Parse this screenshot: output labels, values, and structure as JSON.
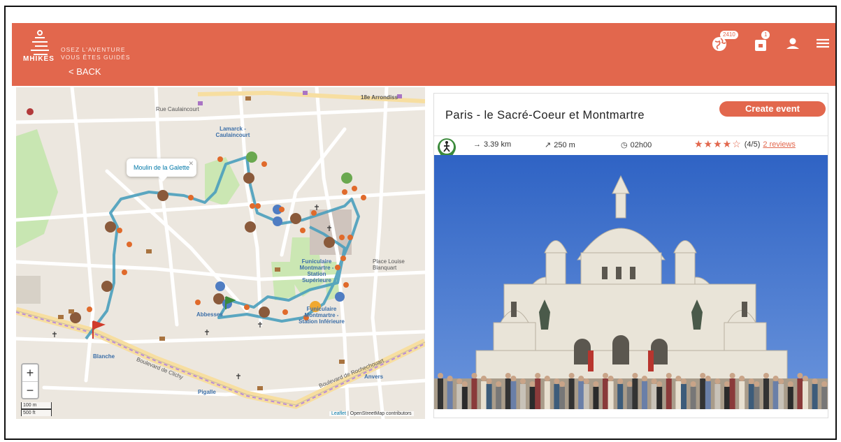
{
  "header": {
    "logo_text": "MHIKES",
    "tagline_line1": "OSEZ L'AVENTURE",
    "tagline_line2": "VOUS ÊTES GUIDÉS",
    "back_label": "< BACK",
    "globe_badge": "2410",
    "cart_badge": "1",
    "icons": [
      "globe-icon",
      "cart-icon",
      "user-icon",
      "menu-icon"
    ],
    "accent_color": "#e2674d"
  },
  "map": {
    "popup_label": "Moulin de la Galette",
    "zoom_in": "+",
    "zoom_out": "−",
    "scale_m": "100 m",
    "scale_ft": "500 ft",
    "attribution_leaflet": "Leaflet",
    "attribution_osm": "| OpenStreetMap contributors",
    "labels": {
      "arrondissement": "18e Arrondiss",
      "lamarck": "Lamarck - Caulaincourt",
      "funiculaire_sup": "Funiculaire Montmartre - Station Supérieure",
      "funiculaire_inf": "Funiculaire Montmartre - Station Inférieure",
      "place_louise": "Place Louise Blanquart",
      "abbesses": "Abbesses",
      "blanche": "Blanche",
      "pigalle": "Pigalle",
      "anvers": "Anvers",
      "bd_clichy": "Boulevard de Clichy",
      "bd_rochechouart": "Boulevard de Rochechouart",
      "rue_caulaincourt": "Rue Caulaincourt"
    },
    "route_color": "#4a9ebc"
  },
  "tour": {
    "title": "Paris - le Sacré-Coeur et Montmartre",
    "create_event_label": "Create event",
    "distance": "3.39 km",
    "elevation": "250 m",
    "duration": "02h00",
    "rating_stars": "★★★★☆",
    "rating_value": 4,
    "rating_max": 5,
    "rating_text": "(4/5)",
    "reviews_label": "2 reviews"
  }
}
